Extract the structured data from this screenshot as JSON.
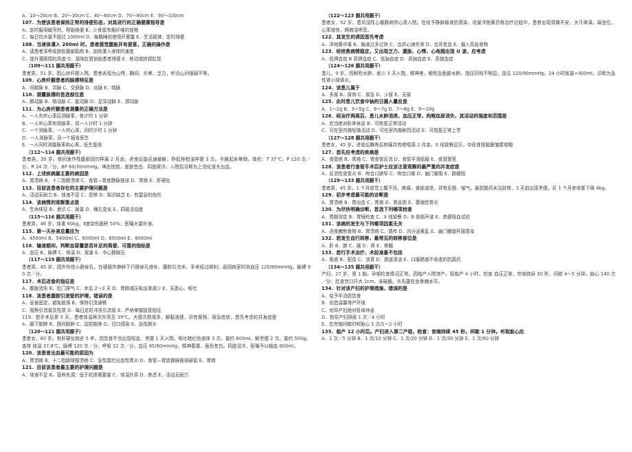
{
  "document": {
    "kind": "scanned-exam-paper",
    "language": "zh-CN",
    "question_range": "107-135"
  },
  "left_column": [
    {
      "type": "opts",
      "name": "q106-options",
      "text": "A．10～20cm     B．20～30cm     C．40～60cm     D．70～80cm     E．90～100cm"
    },
    {
      "type": "q",
      "name": "q107-stem",
      "text": "107．为使该患者保持正常的排便形态，对其进行的正确健康指导是"
    },
    {
      "type": "opts",
      "name": "q107-options-row1",
      "text": "A．定时服用缓泻剂，帮助排便            B．少食富有粗纤维的食物"
    },
    {
      "type": "opts",
      "name": "q107-options-row2",
      "text": "C．每日饮水量不超过 1000ml               D．每晚睡前使用开塞露        E．生活规律，定时排便"
    },
    {
      "type": "q",
      "name": "q108-stem",
      "text": "108．当液体灌入 200ml 时，患者感觉腹胀并有便意，正确的操作是"
    },
    {
      "type": "opts",
      "name": "q108-options-row1",
      "text": "A．请患者深呼吸放松腹部肌肉            B．加快灌入液体的速度"
    },
    {
      "type": "opts",
      "name": "q108-options-row2",
      "text": "C．提升灌肠筒的高度                           D．拔除肛管协助患者排便          E．移动或挤捏肛管"
    },
    {
      "type": "grouphead",
      "name": "group-109-111-header",
      "text": "（109～111 题共用题干）"
    },
    {
      "type": "case",
      "name": "case-109-111",
      "text": "患者男，51 岁。因心房纤颤入院。患者表现为心悸、胸闷、头晕、乏力，听诊心间强弱不等。"
    },
    {
      "type": "q",
      "name": "q109-stem",
      "text": "109．心房纤颤患者的脉搏特征是"
    },
    {
      "type": "opts",
      "name": "q109-options",
      "text": "A．间歇脉            B．洪脉              C．交替脉            D．丝脉              E．绌脉"
    },
    {
      "type": "q",
      "name": "q110-stem",
      "text": "110．测量脉搏的首选部位是"
    },
    {
      "type": "opts",
      "name": "q110-options",
      "text": "A．颞动脉          B．桡动脉          C．肱动脉          D．足背动脉          E．颈动脉"
    },
    {
      "type": "q",
      "name": "q111-stem",
      "text": "111．为心房纤颤患者测量的正确方法是"
    },
    {
      "type": "opts",
      "name": "q111-option-a",
      "text": "A．一人先听心率后测脉率，各计时 1 分钟"
    },
    {
      "type": "opts",
      "name": "q111-option-b",
      "text": "B．一人听心率和测脉率，另一人计时 1 分钟"
    },
    {
      "type": "opts",
      "name": "q111-option-c",
      "text": "C．一个测脉率，一人听心率，同时计时 1 分钟"
    },
    {
      "type": "opts",
      "name": "q111-option-d",
      "text": "D．一人测脉率，另一个报告医生"
    },
    {
      "type": "opts",
      "name": "q111-option-e",
      "text": "E．一人同时测量脉率和心率，医生复测"
    },
    {
      "type": "grouphead",
      "name": "group-112-114-header",
      "text": "（112～114 题共用题干）"
    },
    {
      "type": "case",
      "name": "case-112-114",
      "text": "患者男，30 岁。夜间发作性腹部烧灼样痛 2 月余。进食后能迅速缓解，昨起排柏油样便 3 次。今晨起床晕倒。体检：T 37℃，P 120 次／分，R 24 次／分。BP 60/30mmHg。神志恍惚，皮肤苍白、四肢厥冷。入院后诊断为上消化道大出血。"
    },
    {
      "type": "q",
      "name": "q112-stem",
      "text": "112．上述疾病最主要的病因是"
    },
    {
      "type": "opts",
      "name": "q112-options",
      "text": "A．胃溃疡                        B．十二指肠溃疡          C．食管—胃底静脉曲张          D．胃癌              E．肝硬化"
    },
    {
      "type": "q",
      "name": "q113-stem",
      "text": "113．目前该患者存在的主要护理问题是"
    },
    {
      "type": "opts",
      "name": "q113-options",
      "text": "A．活动无耐力      B．体液不足      C．恐惧      D．知识缺乏      E．有窒息的危险"
    },
    {
      "type": "q",
      "name": "q114-stem",
      "text": "114．该病情的观察重点是"
    },
    {
      "type": "opts",
      "name": "q114-options",
      "text": "A．生命体征        B．意识          C．尿量          D．瞳孔变化          E．四肢活动度"
    },
    {
      "type": "grouphead",
      "name": "group-115-116-header",
      "text": "（115～116 题共用题干）"
    },
    {
      "type": "case",
      "name": "case-115-116",
      "text": "患者男，46 岁，体重 60kg，Ⅱ度烧伤面积 50%，医嘱大量补液。"
    },
    {
      "type": "q",
      "name": "q115-stem",
      "text": "115．第一天补液总量应为"
    },
    {
      "type": "opts",
      "name": "q115-options",
      "text": "A．4500ml      B．5400ml      C．6000ml      D．6500ml      E．8000ml"
    },
    {
      "type": "q",
      "name": "q116-stem",
      "text": "116．输液期间，判断血容量是否补足的简便、可靠的指标是"
    },
    {
      "type": "opts",
      "name": "q116-options",
      "text": "A．血压      B．脉搏      C．体温      D．尿量      E．中心静脉压"
    },
    {
      "type": "grouphead",
      "name": "group-117-119-header",
      "text": "（117～119 题共用题干）"
    },
    {
      "type": "case",
      "name": "case-117-119",
      "text": "患者男，45 岁，因外伤性小肠穿孔。在硬膜外麻醉下行肠穿孔修补、腹腔引流术。手术经过顺利。返回病室时测血压 120/80mmHg。脉搏 90 次／分。"
    },
    {
      "type": "q",
      "name": "q117-stem",
      "text": "117．术后进食的指征是"
    },
    {
      "type": "opts",
      "name": "q117-options",
      "text": "A．腹胀消失                  B．肛门排气              C．术后 2～3 天            D．胃肠减压吸出液减少          E．无恶心、呕吐"
    },
    {
      "type": "q",
      "name": "q118-stem",
      "text": "118．该患者腹腔引流管的护理，错误的是"
    },
    {
      "type": "opts",
      "name": "q118-options-row1",
      "text": "A．妥善固定，避免脱落            B．保持引流通畅"
    },
    {
      "type": "opts",
      "name": "q118-options-row2",
      "text": "C．观察引流量及性质                D．每日定时冲洗引流管        E．严格掌握拔管指征"
    },
    {
      "type": "ln",
      "name": "q119-stem-plain",
      "text": "119．若手术后第 5 天，患者体温再次升高至 39℃。大便次数增多，解黏液便，并有尿频、尿急症状，首先考虑的并发症是"
    },
    {
      "type": "opts",
      "name": "q119-options",
      "text": "A．膈下脓肿      B．肠间脓肿        C．盆腔脓肿      D．切口感染        E．急性肠炎"
    },
    {
      "type": "grouphead",
      "name": "group-120-121-header",
      "text": "（120～121 题共用题子）"
    },
    {
      "type": "case",
      "name": "case-120-121",
      "text": "患者女，60 岁。有肝硬化病史 5 年，因饮食不当出现呕血、黑便 1 天入院。呕吐暗红色液体 3 次，量约 800ml。解黑便 2 次。量约 500g。查体 体温 37.8℃。脉搏 120 次／分，呼吸 22 次／分，血压 85/60mmHg，精神萎靡，面色苍白。四肢湿冷，医嘱予以输血 800ml。"
    },
    {
      "type": "q",
      "name": "q120-stem",
      "text": "120．该患者出血最可能的原因为"
    },
    {
      "type": "opts",
      "name": "q120-options",
      "text": "A．胃溃疡                        B．十二指肠球部溃疡        C．急性糜烂出血性胃炎        D．食管—胃底静脉曲张破裂            E．胃癌"
    },
    {
      "type": "q",
      "name": "q121-stem",
      "text": "121．目前该患者最主要的护理问题是"
    },
    {
      "type": "opts",
      "name": "q121-options",
      "text": "A．体液不足                B．营养失调：低于机体需要量                C．体温升高                D．焦虑                E．活动无耐力"
    }
  ],
  "right_column": [
    {
      "type": "grouphead",
      "name": "group-122-123-header",
      "text": "（122～123 题共用题干）"
    },
    {
      "type": "case",
      "name": "case-122-123",
      "text": "患者女，52 岁。患风湿性心瓣膜病伴心衰入院。在给予静脉输液抗感染、适量泮拖黄药物治疗过程中，患者出现烦躁不安，大汗淋漓。端坐位，心率增快，两肺湿啰音。"
    },
    {
      "type": "q",
      "name": "q122-stem",
      "text": "122．其发生的诱因首先考虑"
    },
    {
      "type": "opts",
      "name": "q122-options",
      "text": "A．洋地黄中毒              B．输液过多过快            C．合并心律失常            D．合并贫血            E．摄入高盐食物"
    },
    {
      "type": "q",
      "name": "q123-stem",
      "text": "123．经抢救病情稳定，又出现乏力、腹胀、心悸，心电图出现 U 波，应考虑"
    },
    {
      "type": "opts",
      "name": "q123-options",
      "text": "A．低钾血症              B 高钾血症            C．低钠血症            D．高钠血症            E．高镁血症"
    },
    {
      "type": "grouphead",
      "name": "group-124-126-header",
      "text": "（124～126 题共用题干）"
    },
    {
      "type": "case",
      "name": "case-124-126",
      "text": "患儿，9 岁。因眼睑水肿，尿少 3 天入院。精神差，眼睑及面部水肿，指压凹陷不明显。血压 120/90mmHg。24 小时尿量<400ml。诊断为急性肾小球肾炎。"
    },
    {
      "type": "q",
      "name": "q124-stem",
      "text": "124．该患儿属于"
    },
    {
      "type": "opts",
      "name": "q124-options",
      "text": "A．多尿            B．尿频              C．尿急            D．少尿            E．无尿"
    },
    {
      "type": "q",
      "name": "q125-stem",
      "text": "125．此时患儿饮食中钠的日摄入量应是"
    },
    {
      "type": "opts",
      "name": "q125-options",
      "text": "A．1～2g          B．3～5g            C．6～7g            D．7～8g            E．9～10g"
    },
    {
      "type": "q",
      "name": "q126-stem",
      "text": "126．经治疗两周后，患儿水肿消退，血压正常，肉眼血尿消失，其活动的强度和范围是"
    },
    {
      "type": "opts",
      "name": "q126-options-row1",
      "text": "A．应当绝对卧床休息                B．可恢复正常活动"
    },
    {
      "type": "opts",
      "name": "q126-options-row2",
      "text": "C．可在室内做轻微活动            D．可在室内做剧烈活动        E．可恢复正常上学"
    },
    {
      "type": "grouphead",
      "name": "group-127-128-header",
      "text": "（127～128 题共用题干）"
    },
    {
      "type": "case",
      "name": "case-127-128",
      "text": "患者女，45 岁。进食后胸骨后刺痛并有哽噎感 2 月余。X 线钡餐显示，中段食管黏膜皱襞增粗"
    },
    {
      "type": "q",
      "name": "q127-stem",
      "text": "127．首先应考虑的疾病是"
    },
    {
      "type": "opts",
      "name": "q127-options",
      "text": "A．食管癌                        B．胃癌              C．胃食管反流              D．食管平滑肌瘤                    E．食管憩室"
    },
    {
      "type": "q",
      "name": "q128-stem",
      "text": "128．该患者行食管手术后护士应该注意观察的最严重的并发症是"
    },
    {
      "type": "opts",
      "name": "q128-options",
      "text": "A．反流性食管炎          B．吻合口狭窄        C．吻合口瘘        D．幽门梗阻        E．肠梗阻"
    },
    {
      "type": "grouphead",
      "name": "group-129-133-header",
      "text": "（129～133 题共用题干）"
    },
    {
      "type": "case",
      "name": "case-129-133",
      "text": "患者男，45 岁。1 个月前觉上腹不适，疼痛，食欲减退，并有反酸、嗳气。服抗酸药未见好转，3 天前出现黑便。近 1 个月来体重下降 4kg。"
    },
    {
      "type": "q",
      "name": "q129-stem",
      "text": "129．初步考虑最可能的诊断是"
    },
    {
      "type": "opts",
      "name": "q129-options",
      "text": "A．胃溃疡                    B．胃出血                        C．胃癌                    D．胃息肉                    E．萎缩性胃炎"
    },
    {
      "type": "q",
      "name": "q130-stem",
      "text": "130．为尽快明确诊断，首选下列哪项检查"
    },
    {
      "type": "opts",
      "name": "q130-options",
      "text": "A．胃酸测定          B．胃镜检查        C．X 线钡餐        D．B 型超声波      E．粪便隐血试验"
    },
    {
      "type": "q",
      "name": "q131-stem",
      "text": "131．该病的发生与下列哪项因素无关"
    },
    {
      "type": "opts",
      "name": "q131-options",
      "text": "A．进食腌制食物              B．胃溃疡                C．遗传              D．内分泌紊乱              E．幽门螺旋杆菌感染"
    },
    {
      "type": "q",
      "name": "q132-stem",
      "text": "132．若发生血行转移，最常见的转移部位是"
    },
    {
      "type": "opts",
      "name": "q132-options",
      "text": "A．肝                    B．肺                    C．胰                D．肾              E．骨髓"
    },
    {
      "type": "q",
      "name": "q133-stem",
      "text": "133．若行手术治疗，术前准备不包括"
    },
    {
      "type": "opts",
      "name": "q133-options",
      "text": "A．备皮                    B．配血                C．洗胃              D．肠道清洁          E．口服肠道不吸收的抗菌药"
    },
    {
      "type": "grouphead",
      "name": "group-134-135-header",
      "text": "（134～135 题共用题干）"
    },
    {
      "type": "case",
      "name": "case-134-135",
      "text": "产妇，27 岁，第 1 胎。孕期检查情况正常。因临产入院待产。现临产 4 小时，检查 血压正常，宫缩持续 30 秒，间歇 4～5 分钟，胎心 140 次／分；肛查宫口开大 2cm。未破膜。头先露在坐骨棘水平。"
    },
    {
      "type": "q",
      "name": "q134-stem",
      "text": "134．针对该产妇的护理措施，错误的是"
    },
    {
      "type": "opts",
      "name": "q134-option-a",
      "text": "A．给予半流质饮食"
    },
    {
      "type": "opts",
      "name": "q134-option-b",
      "text": "B．创造温馨待产环境"
    },
    {
      "type": "opts",
      "name": "q134-option-c",
      "text": "C．劝导产妇绝对卧床休息"
    },
    {
      "type": "opts",
      "name": "q134-option-d",
      "text": "D．指导产妇排尿 1 次／4 小时"
    },
    {
      "type": "opts",
      "name": "q134-option-e",
      "text": "E．在宫缩间歇时听胎心 1 次/1～2 小时"
    },
    {
      "type": "q",
      "name": "q135-stem",
      "text": "135．临产 12 小时后。产妇进入第二产程，检查：宫缩持续 45 秒。间歇 1 分钟。听取胎心应"
    },
    {
      "type": "opts",
      "name": "q135-options",
      "text": "A．1 次／5 分钟              B．1 次/10 分钟            C．1 次/20 分钟              D．1 次/30 分钟          E．1 次/60 分钟"
    }
  ]
}
